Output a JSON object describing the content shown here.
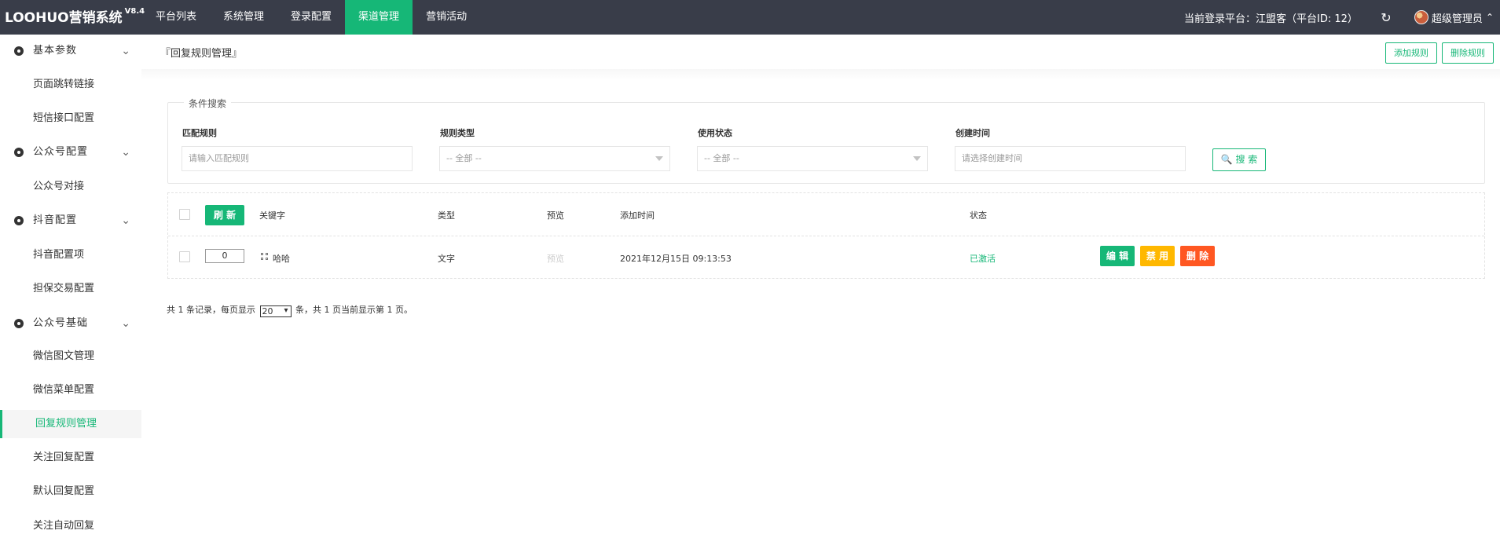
{
  "app": {
    "name": "LOOHUO营销系统",
    "version": "V8.4"
  },
  "topnav": {
    "items": [
      "平台列表",
      "系统管理",
      "登录配置",
      "渠道管理",
      "营销活动"
    ],
    "platform_label": "当前登录平台：江盟客（平台ID: 12）",
    "user_name": "超级管理员",
    "refresh_icon": "↻",
    "chevron_up": "⌃"
  },
  "sidebar": {
    "groups": [
      {
        "label": "基本参数",
        "chevron": "⌄",
        "items": [
          "页面跳转链接",
          "短信接口配置"
        ]
      },
      {
        "label": "公众号配置",
        "chevron": "⌄",
        "items": [
          "公众号对接"
        ]
      },
      {
        "label": "抖音配置",
        "chevron": "⌄",
        "items": [
          "抖音配置项",
          "担保交易配置"
        ]
      },
      {
        "label": "公众号基础",
        "chevron": "⌄",
        "items": [
          "微信图文管理",
          "微信菜单配置",
          "回复规则管理",
          "关注回复配置",
          "默认回复配置",
          "关注自动回复"
        ]
      }
    ]
  },
  "page": {
    "breadcrumb": "『回复规则管理』",
    "buttons": [
      "添加规则",
      "删除规则"
    ]
  },
  "search": {
    "legend": "条件搜索",
    "fields": [
      {
        "label": "匹配规则",
        "placeholder": "请输入匹配规则"
      },
      {
        "label": "规则类型",
        "value": "-- 全部 --"
      },
      {
        "label": "使用状态",
        "value": "-- 全部 --"
      },
      {
        "label": "创建时间",
        "placeholder": "请选择创建时间"
      }
    ],
    "button": "🔍 搜 索"
  },
  "table": {
    "refresh_button": "刷 新",
    "headers": [
      "关键字",
      "类型",
      "预览",
      "添加时间",
      "状态"
    ],
    "row": {
      "sort": "0",
      "keyword": "哈哈",
      "type": "文字",
      "preview": "预览",
      "created_at": "2021年12月15日 09:13:53",
      "status": "已激活",
      "actions": [
        "编 辑",
        "禁 用",
        "删 除"
      ]
    }
  },
  "pagination": {
    "prefix": "共 1 条记录，每页显示",
    "page_size": "20",
    "suffix": "条，共 1 页当前显示第 1 页。"
  },
  "colors": {
    "topbar": "#393d49",
    "primary": "#16b777",
    "warning": "#ffb800",
    "danger": "#ff5722"
  }
}
